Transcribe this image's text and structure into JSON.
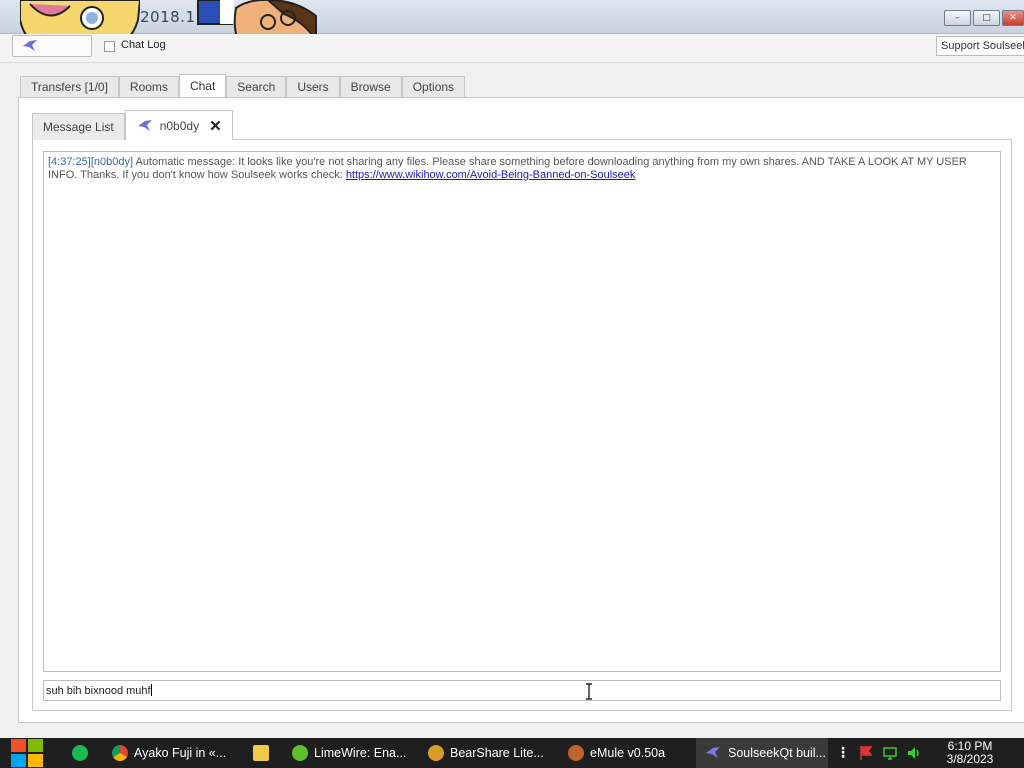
{
  "window": {
    "title": "2018.1",
    "buttons": {
      "minimize": "–",
      "maximize": "□",
      "close": "✕"
    }
  },
  "toolbar": {
    "chat_log_label": "Chat Log",
    "support_label": "Support Soulseek"
  },
  "main_tabs": [
    "Transfers [1/0]",
    "Rooms",
    "Chat",
    "Search",
    "Users",
    "Browse",
    "Options"
  ],
  "inner_tabs": {
    "message_list": "Message List",
    "user_tab": "n0b0dy"
  },
  "chat": {
    "timestamp": "[4:37:25]",
    "user": "[n0b0dy]",
    "message": " Automatic message: It looks like you're not sharing any files. Please share something before downloading anything from my own shares. AND TAKE A LOOK AT MY USER INFO. Thanks. If you don't know how Soulseek works check: ",
    "link": "https://www.wikihow.com/Avoid-Being-Banned-on-Soulseek"
  },
  "input": {
    "value": "suh bih bixnood muhf"
  },
  "taskbar": {
    "tasks": [
      {
        "label": "Ayako Fuji in «...",
        "icon": "chrome-icon",
        "color": "#e8c12c"
      },
      {
        "label": "LimeWire: Ena...",
        "icon": "limewire-icon",
        "color": "#5cbf2a"
      },
      {
        "label": "BearShare Lite...",
        "icon": "bearshare-icon",
        "color": "#d99b2b"
      },
      {
        "label": "eMule v0.50a",
        "icon": "emule-icon",
        "color": "#c0622b"
      },
      {
        "label": "SoulseekQt buil...",
        "icon": "soulseek-icon",
        "color": "#7b7de0"
      }
    ],
    "clock_time": "6:10 PM",
    "clock_date": "3/8/2023"
  },
  "colors": {
    "accent_blue": "#3b6aa8",
    "link": "#1a1ab8",
    "taskbar_bg": "#1f1f1f"
  }
}
